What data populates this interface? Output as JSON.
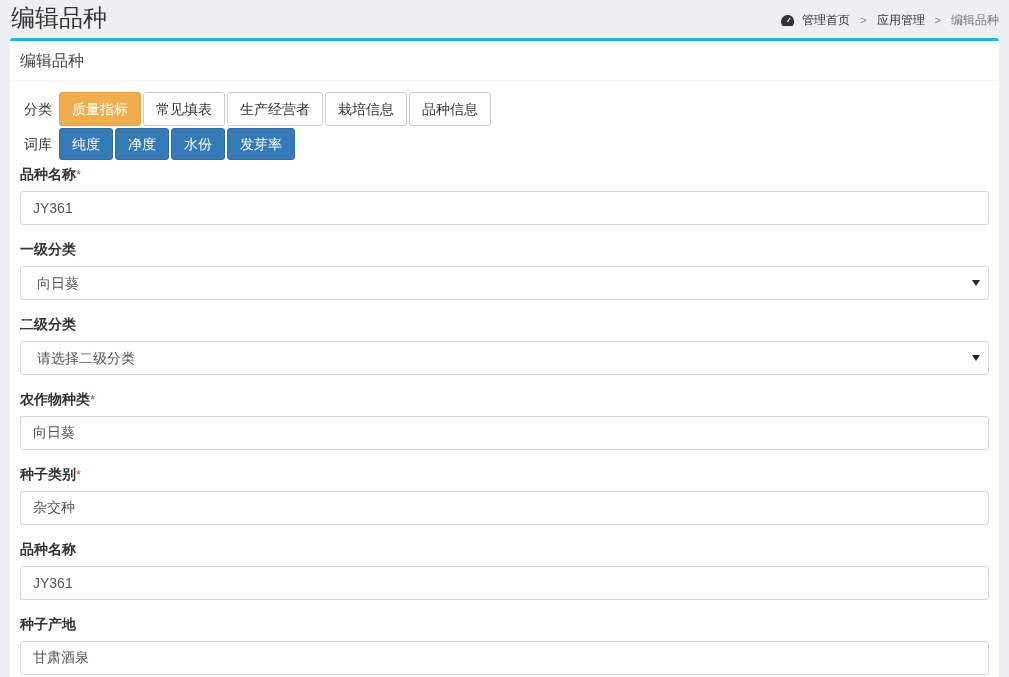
{
  "page_title": "编辑品种",
  "breadcrumb": [
    {
      "label": "管理首页",
      "current": false
    },
    {
      "label": "应用管理",
      "current": false
    },
    {
      "label": "编辑品种",
      "current": true
    }
  ],
  "breadcrumb_separator": ">",
  "panel": {
    "title": "编辑品种",
    "required_mark": "*",
    "category": {
      "label": "分类",
      "options": [
        {
          "label": "质量指标",
          "selected": true
        },
        {
          "label": "常见填表",
          "selected": false
        },
        {
          "label": "生产经营者",
          "selected": false
        },
        {
          "label": "栽培信息",
          "selected": false
        },
        {
          "label": "品种信息",
          "selected": false
        }
      ]
    },
    "lexicon": {
      "label": "词库",
      "terms": [
        "纯度",
        "净度",
        "水份",
        "发芽率"
      ]
    },
    "fields": [
      {
        "label": "品种名称",
        "required": true,
        "kind": "input",
        "value": "JY361"
      },
      {
        "label": "一级分类",
        "required": false,
        "kind": "select",
        "value": "向日葵"
      },
      {
        "label": "二级分类",
        "required": false,
        "kind": "select",
        "value": "请选择二级分类"
      },
      {
        "label": "农作物种类",
        "required": true,
        "kind": "input",
        "value": "向日葵"
      },
      {
        "label": "种子类别",
        "required": true,
        "kind": "input",
        "value": "杂交种"
      },
      {
        "label": "品种名称",
        "required": false,
        "kind": "input",
        "value": "JY361"
      },
      {
        "label": "种子产地",
        "required": false,
        "kind": "input",
        "value": "甘肃酒泉"
      }
    ]
  }
}
